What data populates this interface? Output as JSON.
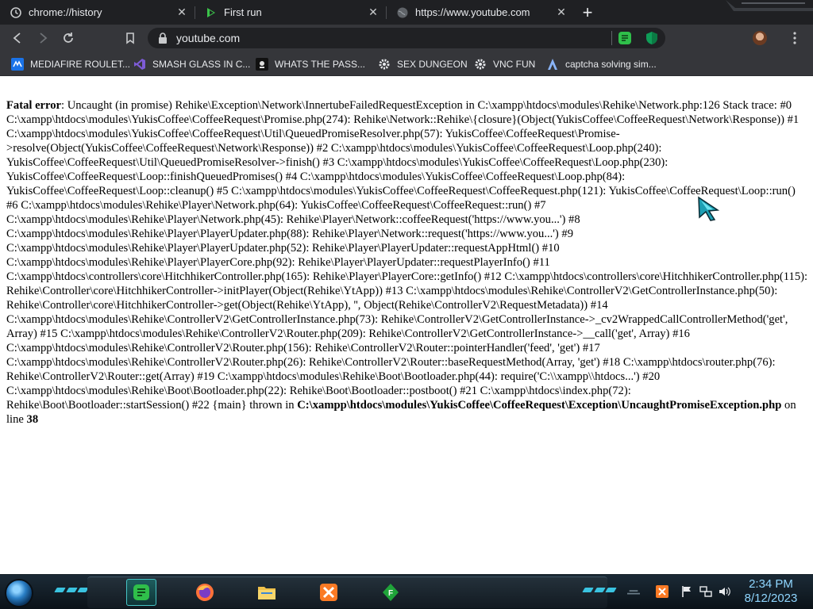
{
  "tabs": [
    {
      "title": "chrome://history",
      "icon": "history-icon"
    },
    {
      "title": "First run",
      "icon": "rehike-icon"
    },
    {
      "title": "https://www.youtube.com",
      "icon": "globe-icon"
    }
  ],
  "toolbar": {
    "url": "youtube.com"
  },
  "bookmarks": [
    {
      "label": "MEDIAFIRE ROULET...",
      "icon": "mediafire-icon"
    },
    {
      "label": "SMASH GLASS IN C...",
      "icon": "visual-studio-icon"
    },
    {
      "label": "WHATS THE PASS...",
      "icon": "dark-site-icon"
    },
    {
      "label": "SEX DUNGEON",
      "icon": "gear-icon"
    },
    {
      "label": "VNC FUN",
      "icon": "gear-icon"
    },
    {
      "label": "captcha solving sim...",
      "icon": "captcha-icon"
    }
  ],
  "error": {
    "label": "Fatal error",
    "message": ": Uncaught (in promise) Rehike\\Exception\\Network\\InnertubeFailedRequestException in C:\\xampp\\htdocs\\modules\\Rehike\\Network.php:126",
    "trace": "Stack trace: #0 C:\\xampp\\htdocs\\modules\\YukisCoffee\\CoffeeRequest\\Promise.php(274): Rehike\\Network::Rehike\\{closure}(Object(YukisCoffee\\CoffeeRequest\\Network\\Response)) #1 C:\\xampp\\htdocs\\modules\\YukisCoffee\\CoffeeRequest\\Util\\QueuedPromiseResolver.php(57): YukisCoffee\\CoffeeRequest\\Promise->resolve(Object(YukisCoffee\\CoffeeRequest\\Network\\Response)) #2 C:\\xampp\\htdocs\\modules\\YukisCoffee\\CoffeeRequest\\Loop.php(240): YukisCoffee\\CoffeeRequest\\Util\\QueuedPromiseResolver->finish() #3 C:\\xampp\\htdocs\\modules\\YukisCoffee\\CoffeeRequest\\Loop.php(230): YukisCoffee\\CoffeeRequest\\Loop::finishQueuedPromises() #4 C:\\xampp\\htdocs\\modules\\YukisCoffee\\CoffeeRequest\\Loop.php(84): YukisCoffee\\CoffeeRequest\\Loop::cleanup() #5 C:\\xampp\\htdocs\\modules\\YukisCoffee\\CoffeeRequest\\CoffeeRequest.php(121): YukisCoffee\\CoffeeRequest\\Loop::run() #6 C:\\xampp\\htdocs\\modules\\Rehike\\Player\\Network.php(64): YukisCoffee\\CoffeeRequest\\CoffeeRequest::run() #7 C:\\xampp\\htdocs\\modules\\Rehike\\Player\\Network.php(45): Rehike\\Player\\Network::coffeeRequest('https://www.you...') #8 C:\\xampp\\htdocs\\modules\\Rehike\\Player\\PlayerUpdater.php(88): Rehike\\Player\\Network::request('https://www.you...') #9 C:\\xampp\\htdocs\\modules\\Rehike\\Player\\PlayerUpdater.php(52): Rehike\\Player\\PlayerUpdater::requestAppHtml() #10 C:\\xampp\\htdocs\\modules\\Rehike\\Player\\PlayerCore.php(92): Rehike\\Player\\PlayerUpdater::requestPlayerInfo() #11 C:\\xampp\\htdocs\\controllers\\core\\HitchhikerController.php(165): Rehike\\Player\\PlayerCore::getInfo() #12 C:\\xampp\\htdocs\\controllers\\core\\HitchhikerController.php(115): Rehike\\Controller\\core\\HitchhikerController->initPlayer(Object(Rehike\\YtApp)) #13 C:\\xampp\\htdocs\\modules\\Rehike\\ControllerV2\\GetControllerInstance.php(50): Rehike\\Controller\\core\\HitchhikerController->get(Object(Rehike\\YtApp), '', Object(Rehike\\ControllerV2\\RequestMetadata)) #14 C:\\xampp\\htdocs\\modules\\Rehike\\ControllerV2\\GetControllerInstance.php(73): Rehike\\ControllerV2\\GetControllerInstance->_cv2WrappedCallControllerMethod('get', Array) #15 C:\\xampp\\htdocs\\modules\\Rehike\\ControllerV2\\Router.php(209): Rehike\\ControllerV2\\GetControllerInstance->__call('get', Array) #16 C:\\xampp\\htdocs\\modules\\Rehike\\ControllerV2\\Router.php(156): Rehike\\ControllerV2\\Router::pointerHandler('feed', 'get') #17 C:\\xampp\\htdocs\\modules\\Rehike\\ControllerV2\\Router.php(26): Rehike\\ControllerV2\\Router::baseRequestMethod(Array, 'get') #18 C:\\xampp\\htdocs\\router.php(76): Rehike\\ControllerV2\\Router::get(Array) #19 C:\\xampp\\htdocs\\modules\\Rehike\\Boot\\Bootloader.php(44): require('C:\\\\xampp\\\\htdocs...') #20 C:\\xampp\\htdocs\\modules\\Rehike\\Boot\\Bootloader.php(22): Rehike\\Boot\\Bootloader::postboot() #21 C:\\xampp\\htdocs\\index.php(72): Rehike\\Boot\\Bootloader::startSession() #22 {main} thrown in",
    "file": "C:\\xampp\\htdocs\\modules\\YukisCoffee\\CoffeeRequest\\Exception\\UncaughtPromiseException.php",
    "on_line_text": " on line ",
    "line": "38"
  },
  "taskbar": {
    "apps": [
      "notes-icon",
      "firefox-icon",
      "file-explorer-icon",
      "xampp-icon",
      "filezilla-icon"
    ]
  },
  "clock": {
    "time": "2:34 PM",
    "date": "8/12/2023"
  },
  "colors": {
    "tab_strip": "#1f2023",
    "toolbar": "#35363a",
    "omnibox": "#202124",
    "taskbar_accent": "#3ac3e0",
    "clock_text": "#8fd6ff"
  }
}
